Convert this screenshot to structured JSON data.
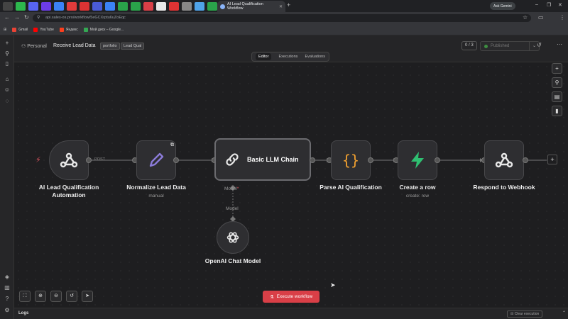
{
  "browser": {
    "active_tab": "AI Lead Qualification Workflow",
    "url": "api.sales-os.pro/workflow/5eGCXrptu6uZoEqc",
    "ask_gemini": "Ask Gemini",
    "bookmarks": [
      "Gmail",
      "YouTube",
      "Яндекс",
      "Мой диск – Google..."
    ]
  },
  "header": {
    "breadcrumb_project": "Personal",
    "workflow_name": "Receive Lead Data",
    "tags": [
      "portfolio",
      "Lead Qual"
    ],
    "counter": "0 / 3",
    "publish_label": "Published"
  },
  "view_tabs": [
    "Editor",
    "Executions",
    "Evaluations"
  ],
  "nodes": {
    "trigger": {
      "title": "AI Lead Qualification Automation",
      "line1": "AI Lead Qualification",
      "line2": "Automation",
      "edge": "POST"
    },
    "normalize": {
      "title": "Normalize Lead Data",
      "subtitle": "manual"
    },
    "llm": {
      "title": "Basic LLM Chain",
      "model_port": "Model",
      "model_edge": "Model"
    },
    "parse": {
      "title": "Parse AI Qualification"
    },
    "create_row": {
      "title": "Create a row",
      "subtitle": "create: row"
    },
    "respond": {
      "title": "Respond to Webhook"
    },
    "openai": {
      "title": "OpenAI Chat Model"
    }
  },
  "toolbar": {
    "execute_label": "Execute workflow"
  },
  "logs": {
    "title": "Logs",
    "clear_label": "Clear execution"
  },
  "colors": {
    "execute": "#d93f47",
    "trigger_bolt": "#e05560",
    "normalize_icon": "#8b7bd8",
    "parse_icon": "#f0a030",
    "create_icon": "#2fbf71"
  }
}
